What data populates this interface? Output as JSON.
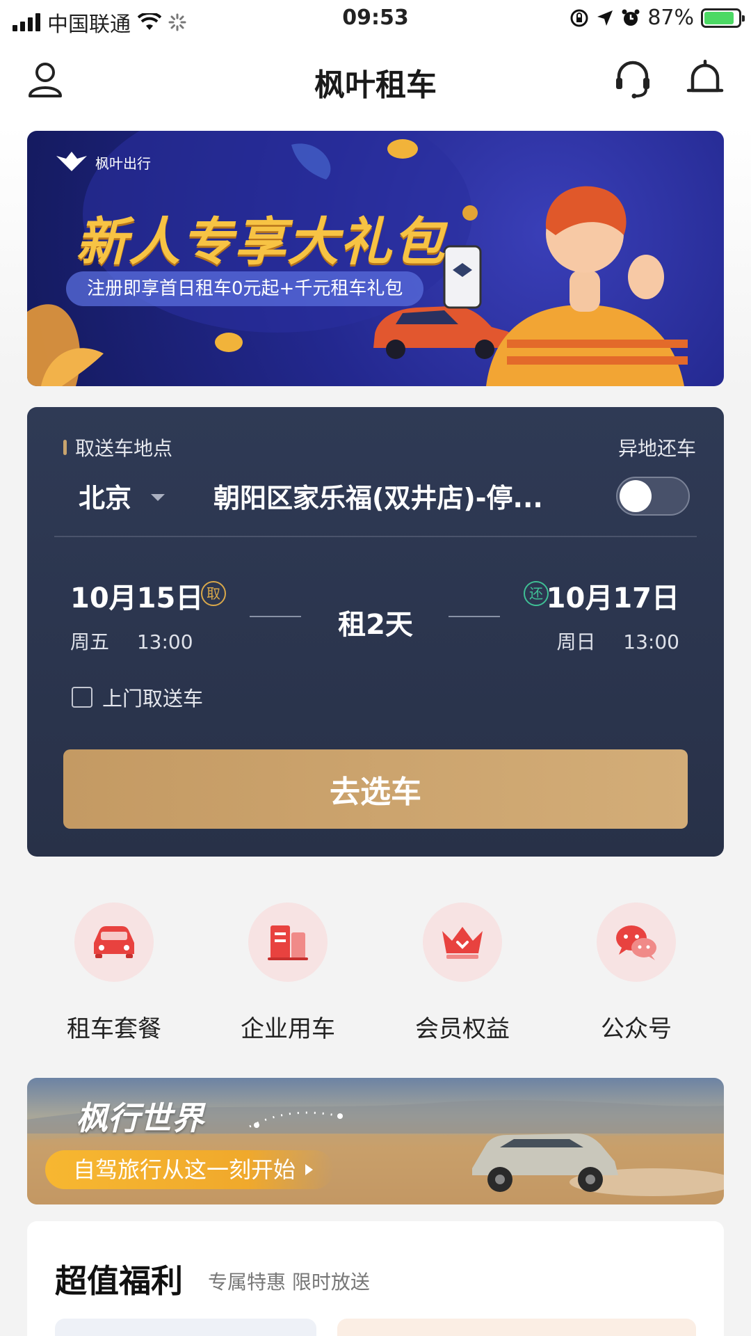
{
  "status_bar": {
    "carrier": "中国联通",
    "time": "09:53",
    "battery_percent": "87%",
    "battery_level": 0.87
  },
  "nav": {
    "title": "枫叶租车",
    "icons": [
      "user-icon",
      "customer-service-icon",
      "bell-icon"
    ]
  },
  "promo_banner": {
    "brand": "枫叶出行",
    "title": "新人专享大礼包",
    "subtitle": "注册即享首日租车0元起+千元租车礼包"
  },
  "booking": {
    "pickup_label": "取送车地点",
    "other_return_label": "异地还车",
    "other_return_enabled": false,
    "city": "北京",
    "address": "朝阳区家乐福(双井店)-停...",
    "pickup_date": "10月15日",
    "pickup_tag": "取",
    "pickup_weekday": "周五",
    "pickup_time": "13:00",
    "duration": "租2天",
    "return_date": "10月17日",
    "return_tag": "还",
    "return_weekday": "周日",
    "return_time": "13:00",
    "door_service_label": "上门取送车",
    "door_service_checked": false,
    "submit_label": "去选车",
    "accent_color": "#c9a26b"
  },
  "quick_entries": [
    {
      "label": "租车套餐",
      "icon": "car-icon"
    },
    {
      "label": "企业用车",
      "icon": "building-icon"
    },
    {
      "label": "会员权益",
      "icon": "crown-icon"
    },
    {
      "label": "公众号",
      "icon": "wechat-icon"
    }
  ],
  "travel_banner": {
    "title": "枫行世界",
    "cta": "自驾旅行从这一刻开始"
  },
  "welfare": {
    "title": "超值福利",
    "subtitle": "专属特惠 限时放送"
  }
}
